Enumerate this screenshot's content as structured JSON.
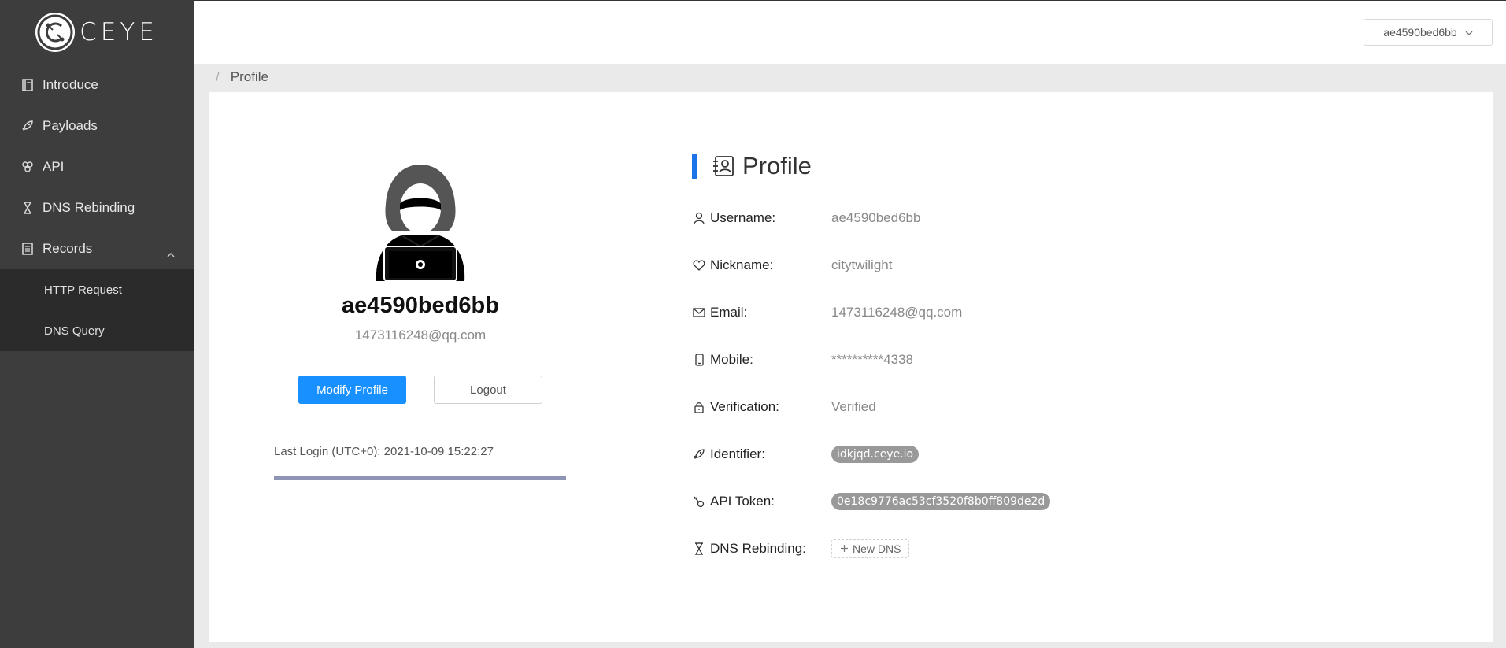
{
  "brand": {
    "name": "CEYE"
  },
  "sidebar": {
    "items": [
      {
        "label": "Introduce",
        "icon": "book-icon"
      },
      {
        "label": "Payloads",
        "icon": "rocket-icon"
      },
      {
        "label": "API",
        "icon": "api-icon"
      },
      {
        "label": "DNS Rebinding",
        "icon": "hourglass-icon"
      },
      {
        "label": "Records",
        "icon": "records-icon",
        "expanded": true
      }
    ],
    "records_sub": [
      {
        "label": "HTTP Request"
      },
      {
        "label": "DNS Query"
      }
    ]
  },
  "header": {
    "user": "ae4590bed6bb"
  },
  "breadcrumb": {
    "sep": "/",
    "current": "Profile"
  },
  "left_panel": {
    "name": "ae4590bed6bb",
    "email": "1473116248@qq.com",
    "modify_label": "Modify Profile",
    "logout_label": "Logout",
    "last_login": "Last Login (UTC+0): 2021-10-09 15:22:27"
  },
  "profile": {
    "title": "Profile",
    "rows": {
      "username": {
        "label": "Username:",
        "value": "ae4590bed6bb"
      },
      "nickname": {
        "label": "Nickname:",
        "value": "citytwilight"
      },
      "email": {
        "label": "Email:",
        "value": "1473116248@qq.com"
      },
      "mobile": {
        "label": "Mobile:",
        "value": "**********4338"
      },
      "verification": {
        "label": "Verification:",
        "value": "Verified"
      },
      "identifier": {
        "label": "Identifier:",
        "value": "idkjqd.ceye.io"
      },
      "api_token": {
        "label": "API Token:",
        "value": "0e18c9776ac53cf3520f8b0ff809de2d"
      },
      "dns_rebinding": {
        "label": "DNS Rebinding:",
        "button": "New DNS"
      }
    }
  },
  "colors": {
    "accent": "#1890ff",
    "sidebar": "#3d3d3d",
    "title_bar": "#1a73e8",
    "tag": "#999999"
  }
}
